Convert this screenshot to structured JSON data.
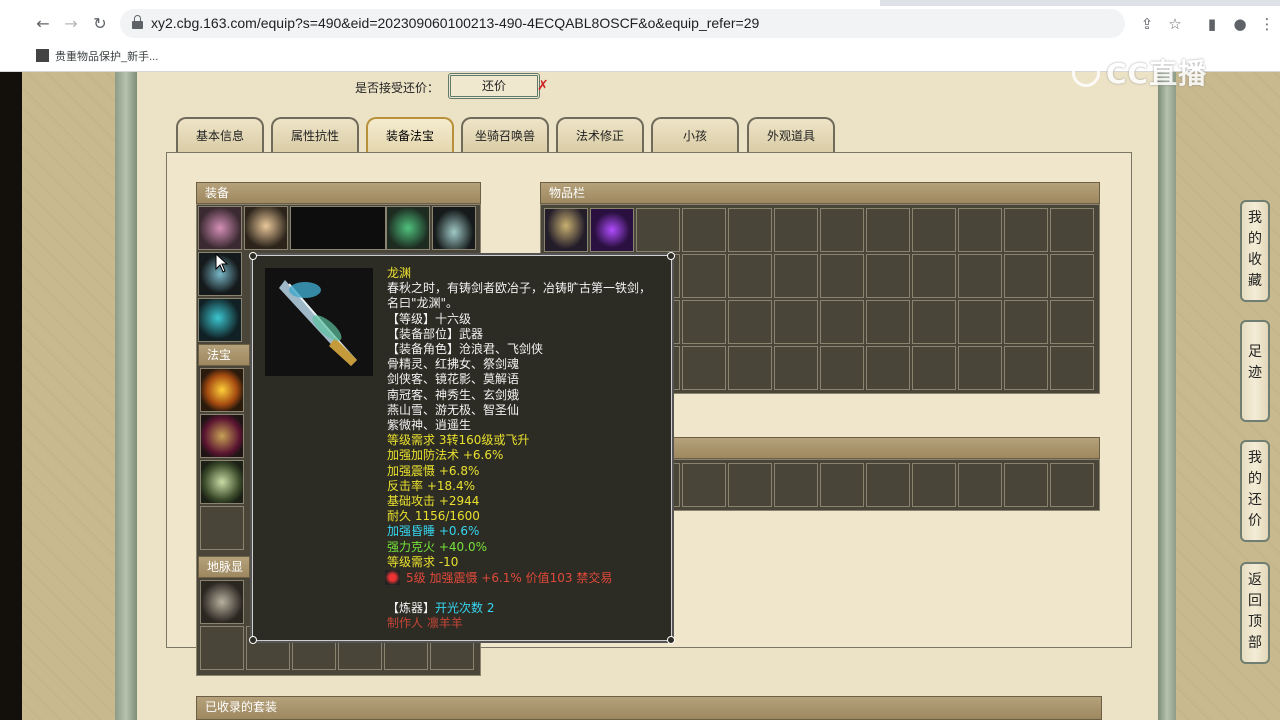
{
  "browser": {
    "url": "xy2.cbg.163.com/equip?s=490&eid=202309060100213-490-4ECQABL8OSCF&o&equip_refer=29",
    "bookmark": "贵重物品保护_新手..."
  },
  "watermark": "CC直播",
  "counter_offer": {
    "label": "是否接受还价：",
    "button": "还价",
    "x_mark": "✗"
  },
  "tabs": [
    {
      "label": "基本信息"
    },
    {
      "label": "属性抗性"
    },
    {
      "label": "装备法宝"
    },
    {
      "label": "坐骑召唤兽"
    },
    {
      "label": "法术修正"
    },
    {
      "label": "小孩"
    },
    {
      "label": "外观道具"
    }
  ],
  "active_tab": "装备法宝",
  "sections": {
    "equipment": "装备",
    "inventory": "物品栏",
    "treasure": "法宝",
    "earth": "地脉显",
    " collected": "",
    "collected_sets": "已收录的套装"
  },
  "sidebar": [
    {
      "label": "我的收藏"
    },
    {
      "label": "足迹"
    },
    {
      "label": "我的还价"
    },
    {
      "label": "返回顶部"
    }
  ],
  "tooltip": {
    "name": "龙渊",
    "desc1": "春秋之时，有铸剑者欧冶子，冶铸旷古第一铁剑，",
    "desc2": "名曰\"龙渊\"。",
    "level": "【等级】十六级",
    "slot": "【装备部位】武器",
    "roles1": "【装备角色】沧浪君、飞剑侠",
    "roles2": "骨精灵、红拂女、祭剑魂",
    "roles3": "剑侠客、镜花影、莫解语",
    "roles4": "南冠客、神秀生、玄剑娥",
    "roles5": "燕山雪、游无极、智圣仙",
    "roles6": "紫微神、逍遥生",
    "req": "等级需求 3转160级或飞升",
    "attr1": "加强加防法术 +6.6%",
    "attr2": "加强震慑 +6.8%",
    "attr3": "反击率 +18.4%",
    "attr4": "基础攻击 +2944",
    "attr5": "耐久 1156/1600",
    "attr6": "加强昏睡 +0.6%",
    "attr7": "强力克火 +40.0%",
    "attr8": "等级需求 -10",
    "gem": "5级 加强震慑 +6.1% 价值103 禁交易",
    "refine_label": "【炼器】",
    "refine_value": "开光次数 2",
    "maker": "制作人 凛羊羊"
  },
  "colors": {
    "panel": "#efe6cb",
    "tooltip_bg": "#2d2c24",
    "header": "#9d8860"
  }
}
